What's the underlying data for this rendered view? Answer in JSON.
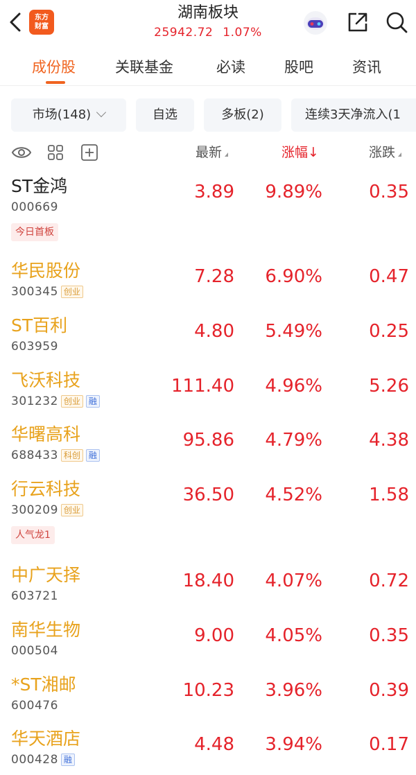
{
  "header": {
    "title": "湖南板块",
    "index_value": "25942.72",
    "index_change": "1.07%",
    "logo_text_top": "东方",
    "logo_text_bottom": "财富"
  },
  "tabs": [
    {
      "label": "成份股",
      "active": true
    },
    {
      "label": "关联基金",
      "active": false
    },
    {
      "label": "必读",
      "active": false
    },
    {
      "label": "股吧",
      "active": false
    },
    {
      "label": "资讯",
      "active": false
    }
  ],
  "filters": [
    {
      "label": "市场(148)"
    },
    {
      "label": "自选"
    },
    {
      "label": "多板(2)"
    },
    {
      "label": "连续3天净流入(1"
    }
  ],
  "columns": {
    "latest": "最新",
    "change_pct": "涨幅",
    "change_pct_arrow": "↓",
    "change": "涨跌"
  },
  "stocks": [
    {
      "name": "ST金鸿",
      "code": "000669",
      "tags": [],
      "extra_tag": "今日首板",
      "latest": "3.89",
      "change_pct": "9.89%",
      "change": "0.35"
    },
    {
      "name": "华民股份",
      "code": "300345",
      "tags": [
        "创业"
      ],
      "extra_tag": "",
      "latest": "7.28",
      "change_pct": "6.90%",
      "change": "0.47"
    },
    {
      "name": "ST百利",
      "code": "603959",
      "tags": [],
      "extra_tag": "",
      "latest": "4.80",
      "change_pct": "5.49%",
      "change": "0.25"
    },
    {
      "name": "飞沃科技",
      "code": "301232",
      "tags": [
        "创业",
        "融"
      ],
      "extra_tag": "",
      "latest": "111.40",
      "change_pct": "4.96%",
      "change": "5.26"
    },
    {
      "name": "华曙高科",
      "code": "688433",
      "tags": [
        "科创",
        "融"
      ],
      "extra_tag": "",
      "latest": "95.86",
      "change_pct": "4.79%",
      "change": "4.38"
    },
    {
      "name": "行云科技",
      "code": "300209",
      "tags": [
        "创业"
      ],
      "extra_tag": "人气龙1",
      "latest": "36.50",
      "change_pct": "4.52%",
      "change": "1.58"
    },
    {
      "name": "中广天择",
      "code": "603721",
      "tags": [],
      "extra_tag": "",
      "latest": "18.40",
      "change_pct": "4.07%",
      "change": "0.72"
    },
    {
      "name": "南华生物",
      "code": "000504",
      "tags": [],
      "extra_tag": "",
      "latest": "9.00",
      "change_pct": "4.05%",
      "change": "0.35"
    },
    {
      "name": "*ST湘邮",
      "code": "600476",
      "tags": [],
      "extra_tag": "",
      "latest": "10.23",
      "change_pct": "3.96%",
      "change": "0.39"
    },
    {
      "name": "华天酒店",
      "code": "000428",
      "tags": [
        "融"
      ],
      "extra_tag": "",
      "latest": "4.48",
      "change_pct": "3.94%",
      "change": "0.17"
    }
  ],
  "colors": {
    "accent": "#f06420",
    "up": "#e5232b",
    "name_gold": "#e8a21c"
  }
}
